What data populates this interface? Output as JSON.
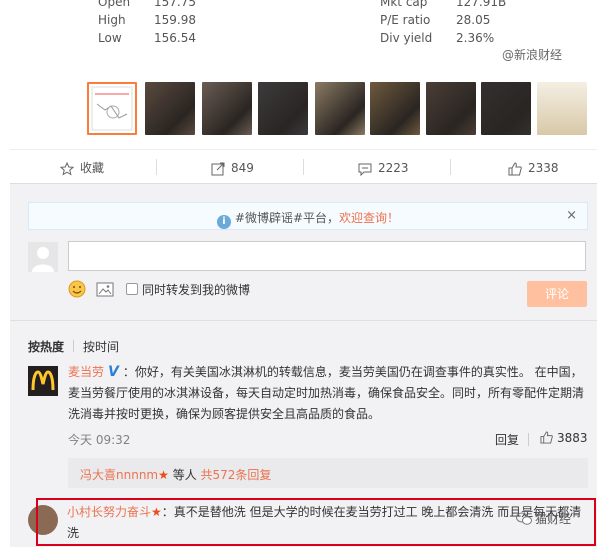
{
  "stock": {
    "rows": [
      {
        "k1": "Open",
        "v1": "157.75",
        "k2": "Mkt cap",
        "v2": "127.91B"
      },
      {
        "k1": "High",
        "v1": "159.98",
        "k2": "P/E ratio",
        "v2": "28.05"
      },
      {
        "k1": "Low",
        "v1": "156.54",
        "k2": "Div yield",
        "v2": "2.36%"
      }
    ],
    "watermark": "@新浪财经"
  },
  "thumbnails": {
    "count": 9,
    "colors": [
      "#f4f4f4",
      "#5a4a3e",
      "#6b5d54",
      "#3c3b3d",
      "#8b7b63",
      "#6e5a3d",
      "#4b3e36",
      "#32302e",
      "#e7ddc8"
    ]
  },
  "actions": {
    "favorite_label": "收藏",
    "repost_count": "849",
    "comment_count": "2223",
    "like_count": "2338"
  },
  "notice": {
    "text_main": "#微博辟谣#平台，",
    "text_accent": "欢迎查询！",
    "close": "×"
  },
  "composer": {
    "placeholder": "",
    "repost_checkbox_label": "同时转发到我的微博",
    "submit_label": "评论"
  },
  "sort_tabs": {
    "hot": "按热度",
    "time": "按时间"
  },
  "top_comment": {
    "user": "麦当劳",
    "badge": "V",
    "text": "：你好，有关美国冰淇淋机的转载信息，麦当劳美国仍在调查事件的真实性。 在中国，麦当劳餐厅使用的冰淇淋设备，每天自动定时加热消毒，确保食品安全。同时，所有零配件定期清洗消毒并按时更换，确保为顾客提供安全且高品质的食品。",
    "time": "今天 09:32",
    "reply_label": "回复",
    "likes": "3883",
    "replies_summary": {
      "user": "冯大喜nnnnm",
      "star": "★",
      "middle": " 等人 ",
      "count": "共572条回复"
    }
  },
  "second_comment": {
    "user": "小村长努力奋斗",
    "star": "★",
    "text": "：真不是替他洗  但是大学的时候在麦当劳打过工   晚上都会清洗    而且是每天都清洗",
    "watermark": "猫财经"
  },
  "colors": {
    "accent": "#eb7350",
    "highlight_border": "#d9001b",
    "submit_bg": "#ffc09f"
  }
}
